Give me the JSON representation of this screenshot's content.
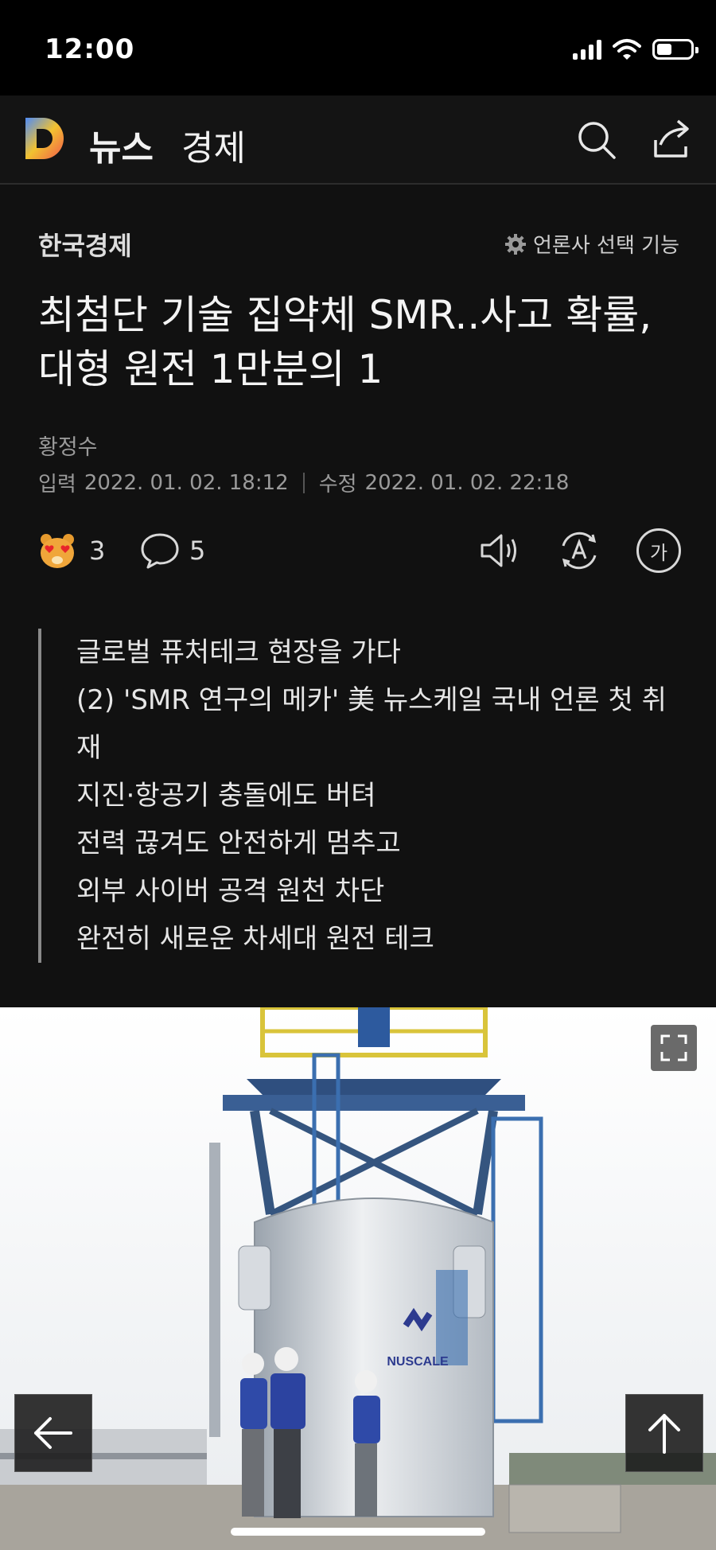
{
  "status": {
    "time": "12:00"
  },
  "header": {
    "title": "뉴스",
    "section": "경제",
    "logo_icon": "daum-logo-icon"
  },
  "article": {
    "publisher": "한국경제",
    "press_select_label": "언론사 선택 기능",
    "headline": "최첨단 기술 집약체 SMR..사고 확률, 대형 원전 1만분의 1",
    "author": "황정수",
    "input_label": "입력",
    "input_date": "2022. 01. 02. 18:12",
    "modified_label": "수정",
    "modified_date": "2022. 01. 02. 22:18"
  },
  "actions": {
    "reaction_count": "3",
    "comment_count": "5",
    "font_size_label": "가"
  },
  "summary": [
    "글로벌 퓨처테크 현장을 가다",
    "(2) 'SMR 연구의 메카' 美 뉴스케일 국내 언론 첫 취재",
    "지진·항공기 충돌에도 버텨",
    "전력 끊겨도 안전하게 멈추고",
    "외부 사이버 공격 원천 차단",
    "완전히 새로운 차세대 원전 테크"
  ],
  "photo": {
    "sign_text": "NUSCALE"
  },
  "colors": {
    "background": "#111111",
    "header": "#141414",
    "text": "#f4f4f4",
    "muted": "#9a9a9a"
  }
}
